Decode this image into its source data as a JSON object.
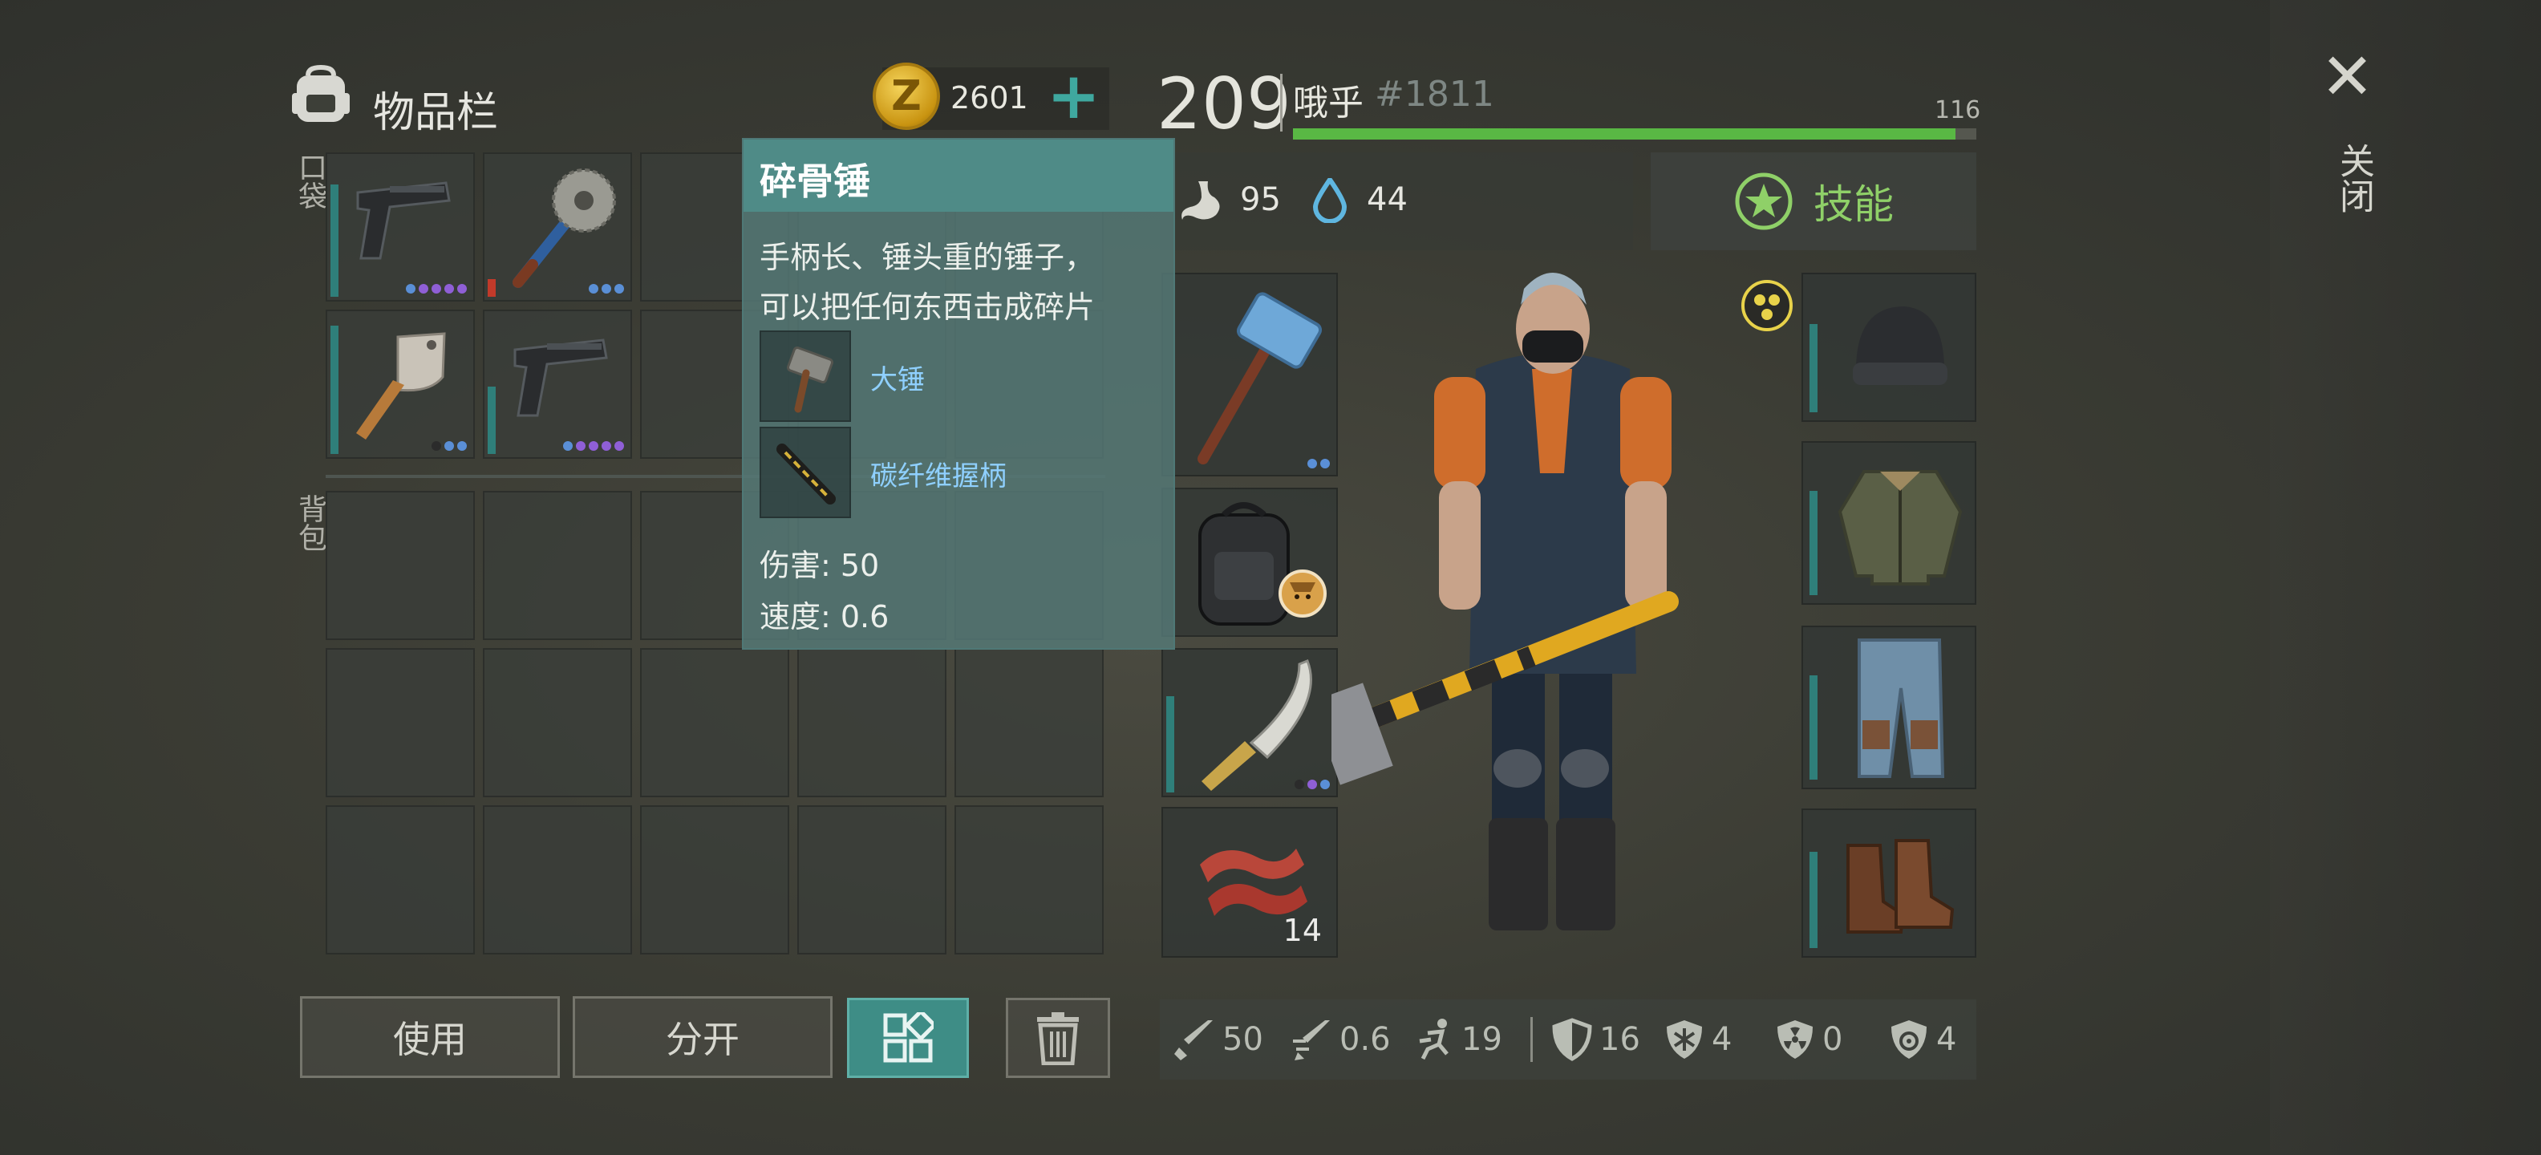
{
  "inventory": {
    "title": "物品栏",
    "pockets_label": "口袋",
    "backpack_label": "背包"
  },
  "currency": {
    "amount": "2601",
    "coin_symbol": "Z"
  },
  "player": {
    "level": "209",
    "name": "哦乎",
    "tag": "#1811",
    "xp_max": "116",
    "xp_progress": 0.97
  },
  "status": {
    "hunger": "95",
    "thirst": "44"
  },
  "skills": {
    "label": "技能"
  },
  "close": {
    "label": "关闭"
  },
  "actions": {
    "use": "使用",
    "split": "分开"
  },
  "tooltip": {
    "title": "碎骨锤",
    "description_lines": [
      "手柄长、锤头重的锤子，",
      "可以把任何东西击成碎片"
    ],
    "components": [
      {
        "name": "大锤",
        "icon": "sledgehammer-icon"
      },
      {
        "name": "碳纤维握柄",
        "icon": "carbon-grip-icon"
      }
    ],
    "stats": [
      "伤害: 50",
      "速度: 0.6"
    ]
  },
  "pocket_items": [
    {
      "icon": "pistol-icon",
      "dots": [
        "#5a8fd6",
        "#8f5fd6",
        "#8f5fd6",
        "#8f5fd6",
        "#8f5fd6"
      ],
      "durability": 0.75
    },
    {
      "icon": "sawblade-mace-icon",
      "dots": [
        "#5a8fd6",
        "#5a8fd6",
        "#5a8fd6"
      ],
      "durability": 0.12
    },
    {
      "icon": "cleaver-icon",
      "dots": [
        "#2b2b2b",
        "#5a8fd6",
        "#5a8fd6"
      ],
      "durability": 0.85
    },
    {
      "icon": "pistol-icon",
      "dots": [
        "#5a8fd6",
        "#8f5fd6",
        "#8f5fd6",
        "#8f5fd6",
        "#8f5fd6"
      ],
      "durability": 0.45
    }
  ],
  "equipment": {
    "weapon": {
      "icon": "hammer-icon",
      "dots": [
        "#5a8fd6",
        "#5a8fd6"
      ]
    },
    "backpack": {
      "icon": "backpack-icon",
      "badge": "cat-badge-icon"
    },
    "melee": {
      "icon": "machete-icon",
      "dots": [
        "#2b2b2b",
        "#8f5fd6",
        "#5a8fd6"
      ]
    },
    "food": {
      "icon": "bacon-icon",
      "count": "14"
    }
  },
  "armor": [
    "beanie-icon",
    "jacket-icon",
    "jeans-icon",
    "boots-icon"
  ],
  "stats_bar": [
    {
      "icon": "damage-sword-icon",
      "value": "50"
    },
    {
      "icon": "attack-speed-icon",
      "value": "0.6"
    },
    {
      "icon": "run-speed-icon",
      "value": "19"
    },
    {
      "icon": "armor-shield-icon",
      "value": "16"
    },
    {
      "icon": "cold-resist-icon",
      "value": "4"
    },
    {
      "icon": "radiation-resist-icon",
      "value": "0"
    },
    {
      "icon": "bio-resist-icon",
      "value": "4"
    }
  ],
  "colors": {
    "accent": "#3e8d86",
    "xp": "#59b844",
    "skills": "#8fd068",
    "tooltip_link": "#8fd0ff"
  }
}
